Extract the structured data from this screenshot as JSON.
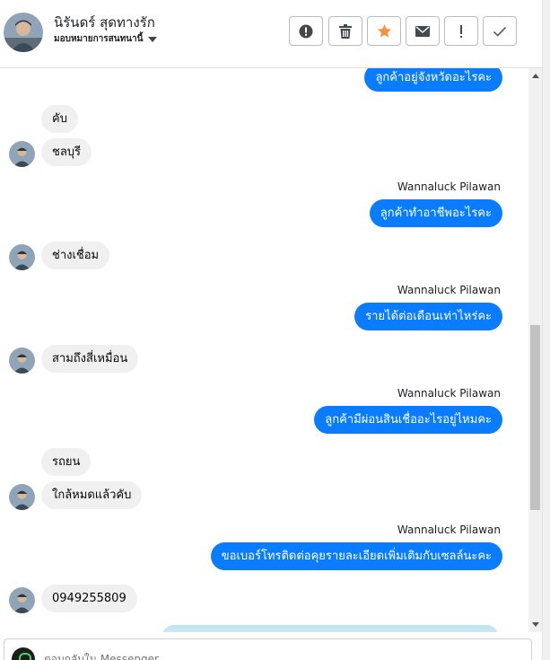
{
  "header": {
    "contact_name": "นิรันดร์ สุดทางรัก",
    "assign_label": "มอบหมายการสนทนานี้",
    "toolbar": {
      "icons": [
        "alert-circle-icon",
        "trash-icon",
        "star-icon",
        "envelope-icon",
        "exclamation-icon",
        "checkmark-icon"
      ],
      "star_color": "#f7923a"
    }
  },
  "colors": {
    "outgoing_bubble": "#0a7cff",
    "incoming_bubble": "#f0f0f0"
  },
  "messages": {
    "m1": "ลูกค้าอยู่จังหวัดอะไรคะ",
    "m2": "คับ",
    "m3": "ชลบุรี",
    "s1": "Wannaluck Pilawan",
    "m4": "ลูกค้าทำอาชีพอะไรคะ",
    "m5": "ช่างเชื่อม",
    "s2": "Wannaluck Pilawan",
    "m6": "รายได้ต่อเดือนเท่าไหร่คะ",
    "m7": "สามถึงสี่เหมื่อน",
    "s3": "Wannaluck Pilawan",
    "m8": "ลูกค้ามีผ่อนสินเชื่ออะไรอยู่ไหมคะ",
    "m9": "รถยน",
    "m10": "ใกล้หมดแล้วคับ",
    "s4": "Wannaluck Pilawan",
    "m11": "ขอเบอร์โทรติดต่อคุยรายละเอียดเพิ่มเติมกับเซลล์นะคะ",
    "m12": "0949255809"
  },
  "composer": {
    "placeholder": "ตอบกลับใน Messenger..."
  }
}
